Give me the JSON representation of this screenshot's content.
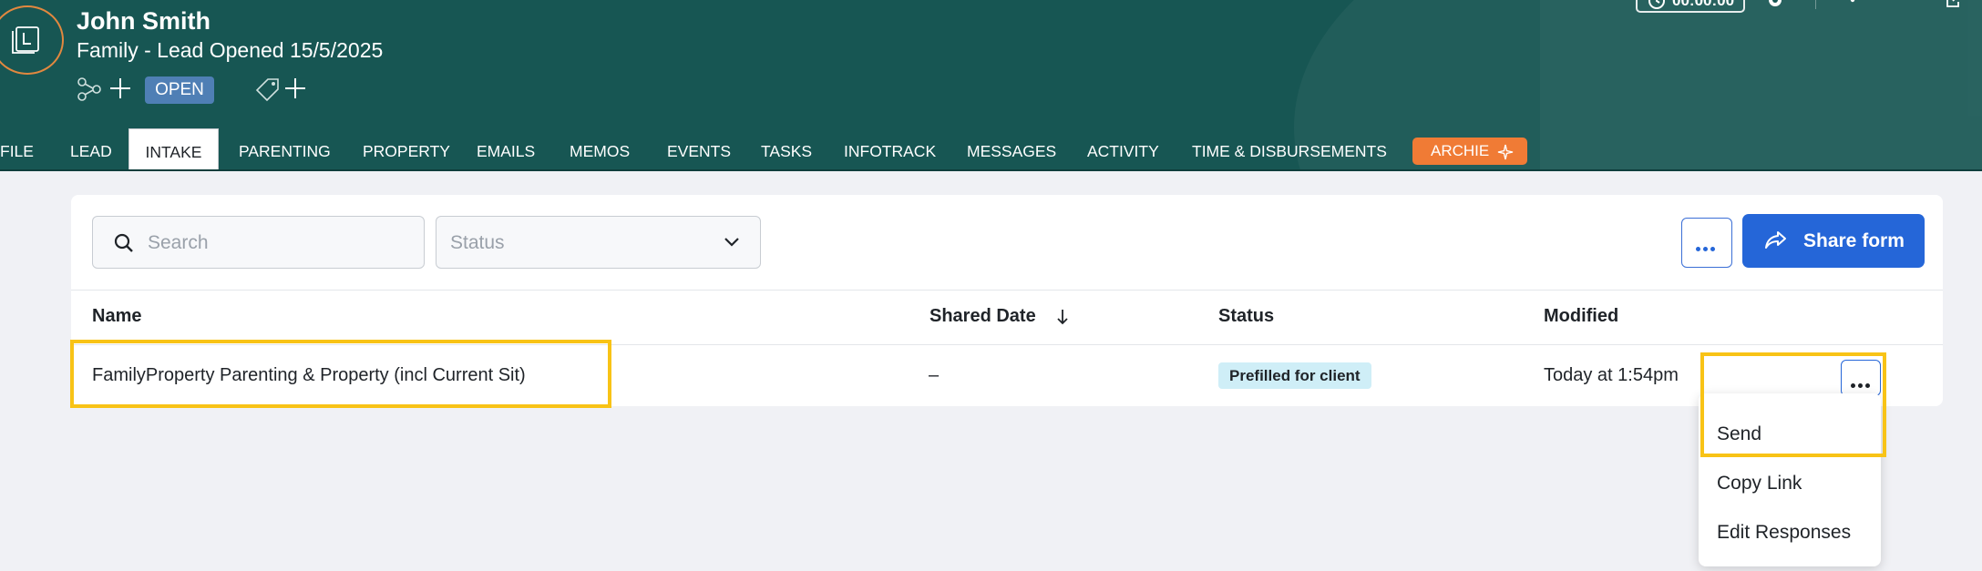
{
  "header": {
    "client_name": "John Smith",
    "matter_subtitle": "Family - Lead Opened 15/5/2025",
    "status_badge": "OPEN",
    "timer": "00:00:00"
  },
  "tabs": [
    {
      "label": "FILE",
      "active": false
    },
    {
      "label": "LEAD",
      "active": false
    },
    {
      "label": "INTAKE",
      "active": true
    },
    {
      "label": "PARENTING",
      "active": false
    },
    {
      "label": "PROPERTY",
      "active": false
    },
    {
      "label": "EMAILS",
      "active": false
    },
    {
      "label": "MEMOS",
      "active": false
    },
    {
      "label": "EVENTS",
      "active": false
    },
    {
      "label": "TASKS",
      "active": false
    },
    {
      "label": "INFOTRACK",
      "active": false
    },
    {
      "label": "MESSAGES",
      "active": false
    },
    {
      "label": "ACTIVITY",
      "active": false
    },
    {
      "label": "TIME & DISBURSEMENTS",
      "active": false
    }
  ],
  "archie": {
    "label": "ARCHIE"
  },
  "toolbar": {
    "search_placeholder": "Search",
    "status_placeholder": "Status",
    "share_label": "Share form"
  },
  "table": {
    "columns": [
      "Name",
      "Shared Date",
      "Status",
      "Modified"
    ],
    "sort_column": "Shared Date",
    "rows": [
      {
        "name": "FamilyProperty Parenting & Property (incl Current Sit)",
        "shared_date": "–",
        "status": "Prefilled for client",
        "modified": "Today at 1:54pm"
      }
    ]
  },
  "row_menu": {
    "items": [
      "Send",
      "Copy Link",
      "Edit Responses"
    ]
  },
  "colors": {
    "header_bg": "#175653",
    "accent_blue": "#2566d8",
    "archie_orange": "#f07b35",
    "badge_blue": "#4f7fb5",
    "status_badge_bg": "#cfeef7",
    "highlight": "#f8c316"
  },
  "icons": {
    "file": "file-l-icon",
    "relationships": "relationship-icon",
    "tag": "tag-icon",
    "timer": "timer-icon",
    "settings": "gear-icon",
    "more": "kebab-icon",
    "minimize": "minimize-icon",
    "popout": "popout-icon",
    "search": "search-icon",
    "chevron": "chevron-down-icon",
    "share": "share-arrow-icon",
    "sort": "arrow-down-icon",
    "sparkle": "sparkle-icon"
  }
}
